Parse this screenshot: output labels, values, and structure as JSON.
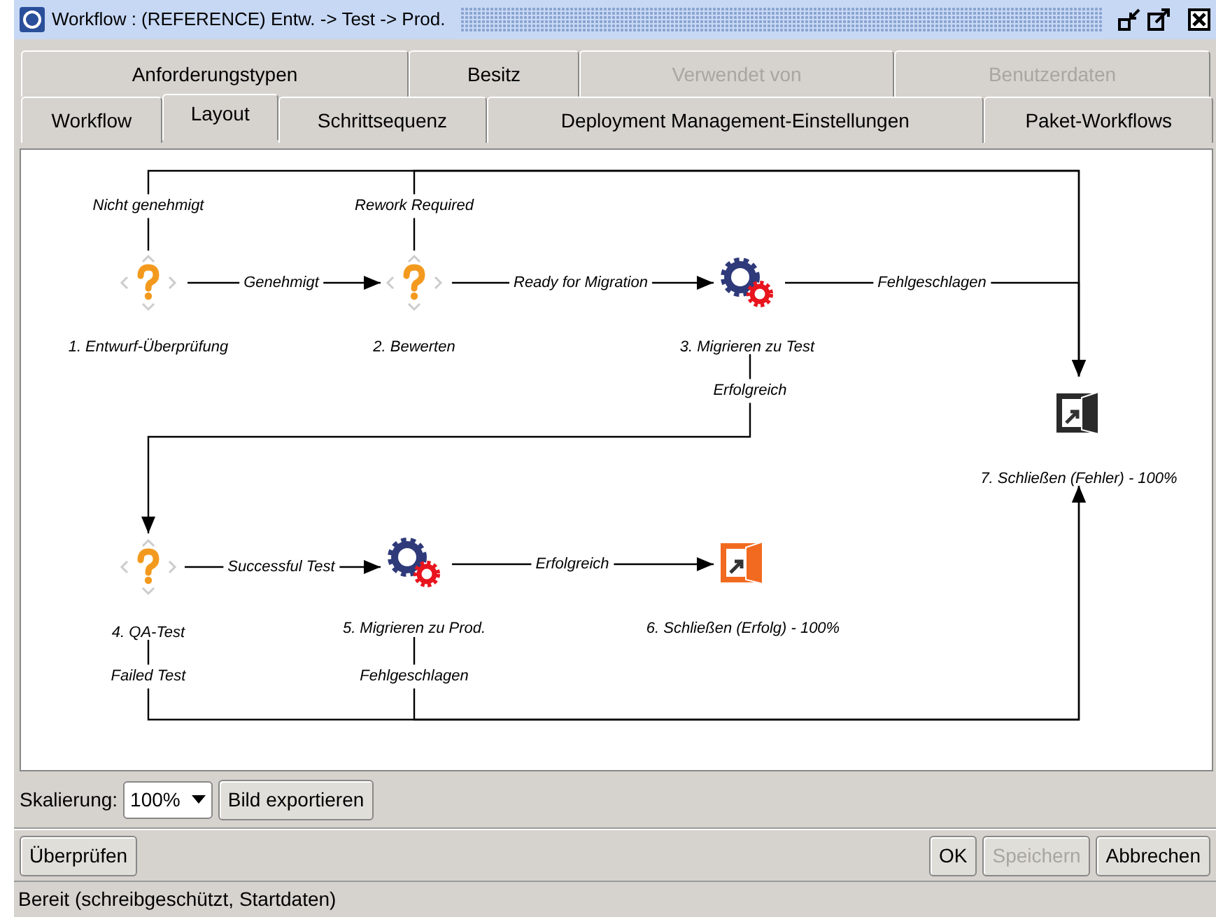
{
  "window": {
    "title": "Workflow : (REFERENCE) Entw. -> Test -> Prod."
  },
  "tab_rows": [
    [
      {
        "label": "Anforderungstypen",
        "selected": false,
        "disabled": false
      },
      {
        "label": "Besitz",
        "selected": false,
        "disabled": false
      },
      {
        "label": "Verwendet von",
        "selected": false,
        "disabled": true
      },
      {
        "label": "Benutzerdaten",
        "selected": false,
        "disabled": true
      }
    ],
    [
      {
        "label": "Workflow",
        "selected": false,
        "disabled": false
      },
      {
        "label": "Layout",
        "selected": true,
        "disabled": false
      },
      {
        "label": "Schrittsequenz",
        "selected": false,
        "disabled": false
      },
      {
        "label": "Deployment Management-Einstellungen",
        "selected": false,
        "disabled": false
      },
      {
        "label": "Paket-Workflows",
        "selected": false,
        "disabled": false
      }
    ]
  ],
  "diagram": {
    "nodes": [
      {
        "label": "1. Entwurf-Überprüfung",
        "kind": "decision"
      },
      {
        "label": "2. Bewerten",
        "kind": "decision"
      },
      {
        "label": "3. Migrieren zu Test",
        "kind": "execution"
      },
      {
        "label": "4. QA-Test",
        "kind": "decision"
      },
      {
        "label": "5. Migrieren zu Prod.",
        "kind": "execution"
      },
      {
        "label": "6. Schließen (Erfolg) - 100%",
        "kind": "close",
        "color": "#f26a1f"
      },
      {
        "label": "7. Schließen (Fehler) - 100%",
        "kind": "close",
        "color": "#2a2a2a"
      }
    ],
    "edges": [
      {
        "label": "Nicht genehmigt"
      },
      {
        "label": "Rework Required"
      },
      {
        "label": "Genehmigt"
      },
      {
        "label": "Ready for Migration"
      },
      {
        "label": "Fehlgeschlagen"
      },
      {
        "label": "Erfolgreich"
      },
      {
        "label": "Successful Test"
      },
      {
        "label": "Erfolgreich"
      },
      {
        "label": "Failed Test"
      },
      {
        "label": "Fehlgeschlagen"
      }
    ]
  },
  "zoom": {
    "label": "Skalierung:",
    "value": "100%",
    "export_button": "Bild exportieren"
  },
  "buttons": [
    {
      "label": "Überprüfen",
      "disabled": false
    },
    {
      "label": "OK",
      "disabled": false
    },
    {
      "label": "Speichern",
      "disabled": true
    },
    {
      "label": "Abbrechen",
      "disabled": false
    }
  ],
  "status_bar": "Bereit (schreibgeschützt, Startdaten)"
}
